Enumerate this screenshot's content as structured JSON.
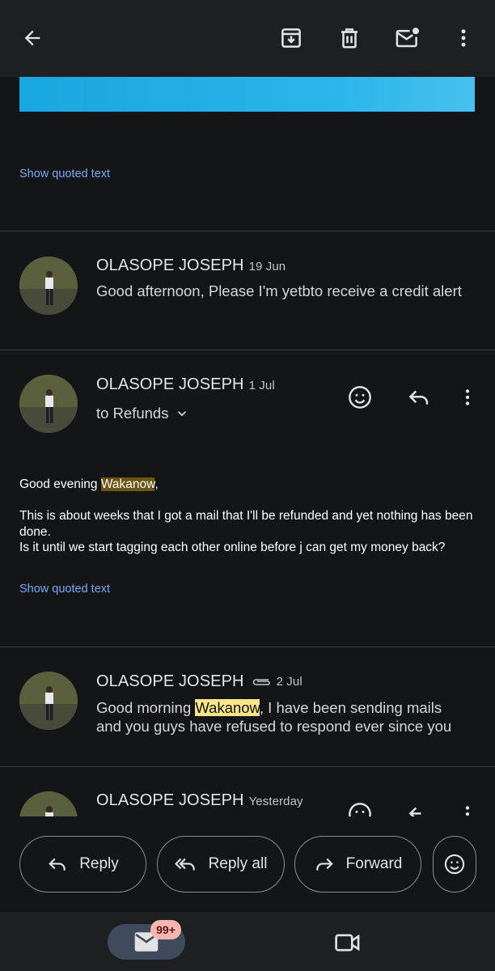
{
  "toolbar": {
    "back_icon": "arrow-back-icon",
    "archive_icon": "archive-icon",
    "delete_icon": "trash-icon",
    "unread_icon": "mark-unread-icon",
    "more_icon": "more-vert-icon"
  },
  "thread": {
    "show_quoted_label": "Show quoted text",
    "messages": [
      {
        "sender": "OLASOPE JOSEPH",
        "date": "19 Jun",
        "preview": "Good afternoon, Please I'm yetbto receive a credit alert"
      },
      {
        "sender": "OLASOPE JOSEPH",
        "date": "1 Jul",
        "recipient": "to Refunds",
        "greeting_prefix": "Good evening ",
        "greeting_highlight": "Wakanow",
        "greeting_suffix": ",",
        "body_line1": "This is about weeks that I got a mail that I'll be refunded and yet nothing has been done.",
        "body_line2": "Is it until we start tagging each other online before j can get my money back?"
      },
      {
        "sender": "OLASOPE JOSEPH",
        "date": "2 Jul",
        "has_attachment": true,
        "preview_prefix": "Good morning ",
        "preview_highlight": "Wakanow",
        "preview_suffix": ", I have been sending mails and you guys have refused to respond ever since you"
      },
      {
        "sender": "OLASOPE JOSEPH",
        "date": "Yesterday"
      }
    ]
  },
  "actions": {
    "reply_label": "Reply",
    "reply_all_label": "Reply all",
    "forward_label": "Forward"
  },
  "bottom_nav": {
    "mail_badge": "99+"
  },
  "colors": {
    "background": "#141519",
    "link": "#7aa7f0",
    "highlight_dark": "#6b5512",
    "highlight_light": "#fde68a",
    "badge": "#f9b6b0"
  }
}
